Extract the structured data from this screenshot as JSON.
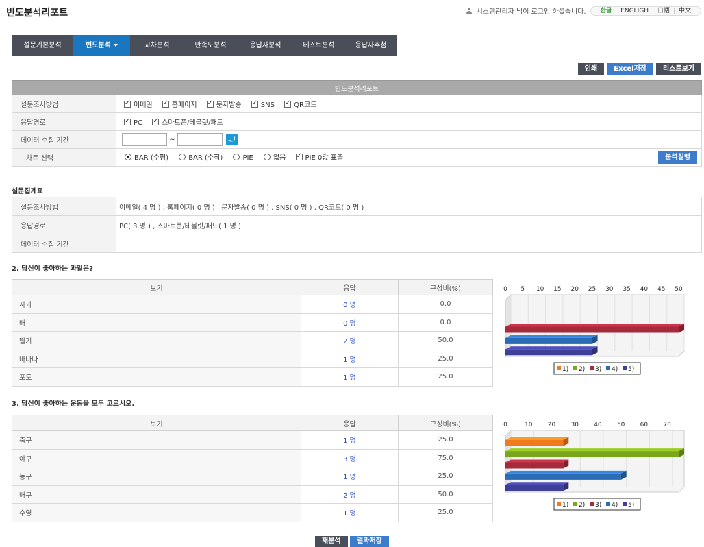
{
  "page_title": "빈도분석리포트",
  "user_status": "시스템관리자 님이 로그인 하셨습니다.",
  "languages": [
    "한글",
    "ENGLIGH",
    "日語",
    "中文"
  ],
  "nav": [
    {
      "label": "설문기본분석",
      "active": false
    },
    {
      "label": "빈도분석",
      "active": true
    },
    {
      "label": "교차분석",
      "active": false
    },
    {
      "label": "만족도분석",
      "active": false
    },
    {
      "label": "응답자분석",
      "active": false
    },
    {
      "label": "테스트분석",
      "active": false
    },
    {
      "label": "응답자추첨",
      "active": false
    }
  ],
  "actions": {
    "print": "인쇄",
    "excel": "Excel저장",
    "list": "리스트보기"
  },
  "filter": {
    "header": "빈도분석리포트",
    "method_label": "설문조사방법",
    "methods": [
      "이메일",
      "홈페이지",
      "문자발송",
      "SNS",
      "QR코드"
    ],
    "route_label": "응답경로",
    "routes": [
      "PC",
      "스마트폰/테블릿/패드"
    ],
    "period_label": "데이터 수집 기간",
    "period_from": "",
    "period_to": "",
    "period_sep": "~",
    "chart_label": "차트 선택",
    "chart_options": [
      "BAR (수평)",
      "BAR (수직)",
      "PIE",
      "없음"
    ],
    "chart_selected": "BAR (수평)",
    "pie_zero": "PIE 0값 표출",
    "run": "분석실행"
  },
  "summary": {
    "title": "설문집계표",
    "method_label": "설문조사방법",
    "method_value": "이메일( 4 명 ) , 홈페이지( 0 명 ) , 문자발송( 0 명 ) , SNS( 0 명 ) , QR코드( 0 명 )",
    "route_label": "응답경로",
    "route_value": "PC( 3 명 ) , 스마트폰/테블릿/패드( 1 명 )",
    "period_label": "데이터 수집 기간",
    "period_value": ""
  },
  "table_headers": {
    "option": "보기",
    "response": "응답",
    "ratio": "구성비(%)"
  },
  "questions": [
    {
      "title": "2. 당신이 좋아하는 과일은?",
      "rows": [
        {
          "option": "사과",
          "response": "0 명",
          "ratio": "0.0"
        },
        {
          "option": "배",
          "response": "0 명",
          "ratio": "0.0"
        },
        {
          "option": "딸기",
          "response": "2 명",
          "ratio": "50.0"
        },
        {
          "option": "바나나",
          "response": "1 명",
          "ratio": "25.0"
        },
        {
          "option": "포도",
          "response": "1 명",
          "ratio": "25.0"
        }
      ]
    },
    {
      "title": "3. 당신이 좋아하는 운동을 모두 고르시오.",
      "rows": [
        {
          "option": "축구",
          "response": "1 명",
          "ratio": "25.0"
        },
        {
          "option": "야구",
          "response": "3 명",
          "ratio": "75.0"
        },
        {
          "option": "농구",
          "response": "1 명",
          "ratio": "25.0"
        },
        {
          "option": "배구",
          "response": "2 명",
          "ratio": "50.0"
        },
        {
          "option": "수영",
          "response": "1 명",
          "ratio": "25.0"
        }
      ]
    }
  ],
  "chart_data": [
    {
      "type": "bar",
      "orientation": "horizontal",
      "categories": [
        "1)",
        "2)",
        "3)",
        "4)",
        "5)"
      ],
      "values": [
        0,
        0,
        50,
        25,
        25
      ],
      "xlim": [
        0,
        50
      ],
      "ticks": [
        0,
        5,
        10,
        15,
        20,
        25,
        30,
        35,
        40,
        45,
        50
      ],
      "colors": [
        "#f07a1e",
        "#7aa51c",
        "#a52a3c",
        "#2a6cb5",
        "#3e3f96"
      ],
      "legend": "bottom"
    },
    {
      "type": "bar",
      "orientation": "horizontal",
      "categories": [
        "1)",
        "2)",
        "3)",
        "4)",
        "5)"
      ],
      "values": [
        25,
        75,
        25,
        50,
        25
      ],
      "xlim": [
        0,
        75
      ],
      "ticks": [
        0,
        10,
        20,
        30,
        40,
        50,
        60,
        70
      ],
      "colors": [
        "#f07a1e",
        "#7aa51c",
        "#a52a3c",
        "#2a6cb5",
        "#3e3f96"
      ],
      "legend": "bottom"
    }
  ],
  "bottom": {
    "reanalyze": "재분석",
    "save": "결과저장"
  }
}
